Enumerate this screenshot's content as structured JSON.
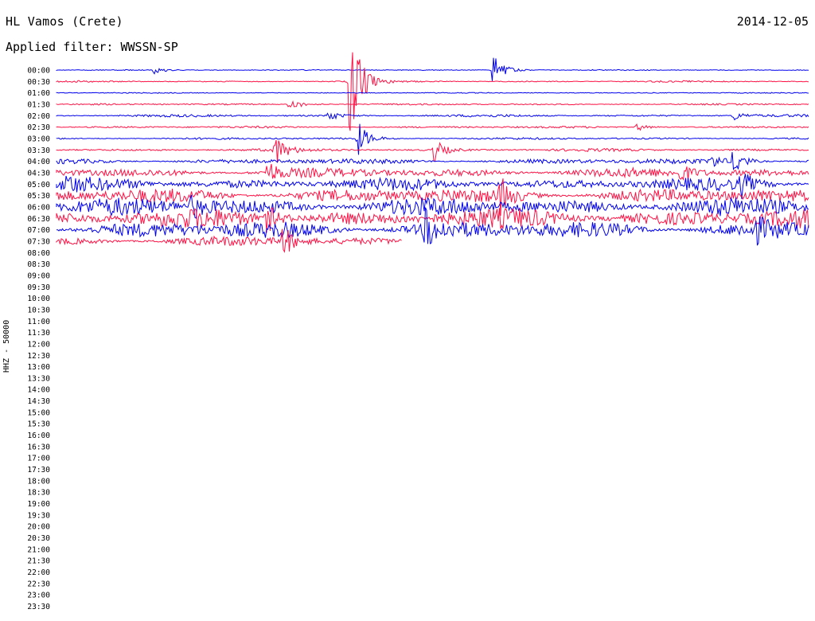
{
  "header": {
    "station": "HL Vamos (Crete)",
    "date": "2014-12-05",
    "filter": "Applied filter: WWSSN-SP"
  },
  "chart_data": {
    "type": "line",
    "subtype": "helicorder",
    "title": "HL Vamos (Crete)",
    "date": "2014-12-05",
    "filter": "WWSSN-SP",
    "channel_label": "HHZ - 50000",
    "rows": [
      "00:00",
      "00:30",
      "01:00",
      "01:30",
      "02:00",
      "02:30",
      "03:00",
      "03:30",
      "04:00",
      "04:30",
      "05:00",
      "05:30",
      "06:00",
      "06:30",
      "07:00",
      "07:30",
      "08:00",
      "08:30",
      "09:00",
      "09:30",
      "10:00",
      "10:30",
      "11:00",
      "11:30",
      "12:00",
      "12:30",
      "13:00",
      "13:30",
      "14:00",
      "14:30",
      "15:00",
      "15:30",
      "16:00",
      "16:30",
      "17:00",
      "17:30",
      "18:00",
      "18:30",
      "19:00",
      "19:30",
      "20:00",
      "20:30",
      "21:00",
      "21:30",
      "22:00",
      "22:30",
      "23:00",
      "23:30"
    ],
    "series_colors": [
      "#0000ee",
      "#ff1144"
    ],
    "recorded_rows": 16,
    "last_row_fraction": 0.46,
    "row_noise_level": [
      0.05,
      0.08,
      0.05,
      0.08,
      0.12,
      0.1,
      0.1,
      0.14,
      0.25,
      0.45,
      0.6,
      0.7,
      0.9,
      0.95,
      0.85,
      0.45
    ],
    "events": [
      {
        "row": 0,
        "pos": 0.58,
        "amp": 1.4
      },
      {
        "row": 0,
        "pos": 0.13,
        "amp": 0.3
      },
      {
        "row": 1,
        "pos": 0.39,
        "amp": 6.0
      },
      {
        "row": 3,
        "pos": 0.31,
        "amp": 0.6
      },
      {
        "row": 4,
        "pos": 0.36,
        "amp": 0.5
      },
      {
        "row": 4,
        "pos": 0.9,
        "amp": 0.4
      },
      {
        "row": 5,
        "pos": 0.77,
        "amp": 0.4
      },
      {
        "row": 6,
        "pos": 0.4,
        "amp": 1.6
      },
      {
        "row": 7,
        "pos": 0.29,
        "amp": 1.4
      },
      {
        "row": 7,
        "pos": 0.5,
        "amp": 1.2
      },
      {
        "row": 8,
        "pos": 0.9,
        "amp": 1.4
      },
      {
        "row": 8,
        "pos": 0.87,
        "amp": 0.7
      },
      {
        "row": 9,
        "pos": 0.28,
        "amp": 1.1
      },
      {
        "row": 9,
        "pos": 0.83,
        "amp": 0.9
      },
      {
        "row": 10,
        "pos": 0.91,
        "amp": 1.0
      },
      {
        "row": 10,
        "pos": 0.01,
        "amp": 0.8
      },
      {
        "row": 11,
        "pos": 0.59,
        "amp": 1.4
      },
      {
        "row": 12,
        "pos": 0.18,
        "amp": 1.0
      },
      {
        "row": 13,
        "pos": 0.28,
        "amp": 1.2
      },
      {
        "row": 14,
        "pos": 0.49,
        "amp": 1.6
      },
      {
        "row": 14,
        "pos": 0.93,
        "amp": 0.8
      },
      {
        "row": 15,
        "pos": 0.3,
        "amp": 1.5
      }
    ]
  }
}
